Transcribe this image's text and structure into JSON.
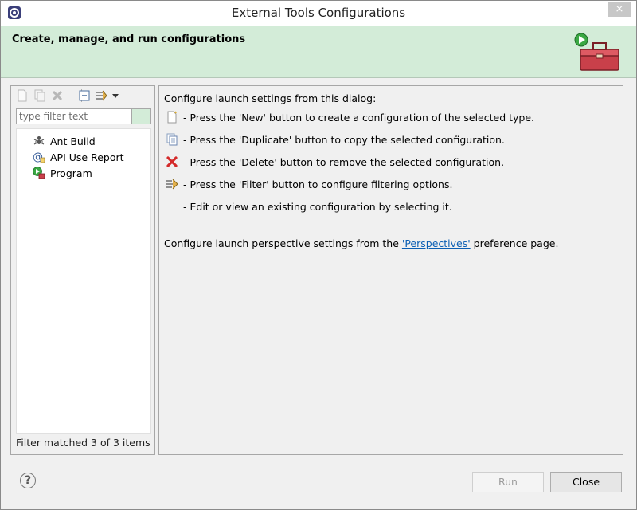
{
  "window": {
    "title": "External Tools Configurations",
    "close_glyph": "×"
  },
  "banner": {
    "heading": "Create, manage, and run configurations",
    "icon": "toolbox-run-icon"
  },
  "toolbar": {
    "icons": [
      "new-config-icon",
      "duplicate-icon",
      "delete-icon",
      "collapse-all-icon",
      "filter-icon",
      "dropdown-arrow-icon"
    ]
  },
  "filter": {
    "placeholder": "type filter text",
    "value": ""
  },
  "tree": {
    "items": [
      {
        "label": "Ant Build",
        "icon": "ant-icon"
      },
      {
        "label": "API Use Report",
        "icon": "api-report-icon"
      },
      {
        "label": "Program",
        "icon": "program-icon"
      }
    ]
  },
  "status": "Filter matched 3 of 3 items",
  "help": {
    "intro": "Configure launch settings from this dialog:",
    "lines": [
      "- Press the 'New' button to create a configuration of the selected type.",
      "- Press the 'Duplicate' button to copy the selected configuration.",
      "- Press the 'Delete' button to remove the selected configuration.",
      "- Press the 'Filter' button to configure filtering options.",
      "- Edit or view an existing configuration by selecting it."
    ],
    "perspective_prefix": "Configure launch perspective settings from the ",
    "perspective_link": "'Perspectives'",
    "perspective_suffix": " preference page."
  },
  "buttons": {
    "run": "Run",
    "close": "Close",
    "help_glyph": "?"
  },
  "colors": {
    "banner_bg": "#d3ecd8",
    "link": "#0b5fb4"
  }
}
